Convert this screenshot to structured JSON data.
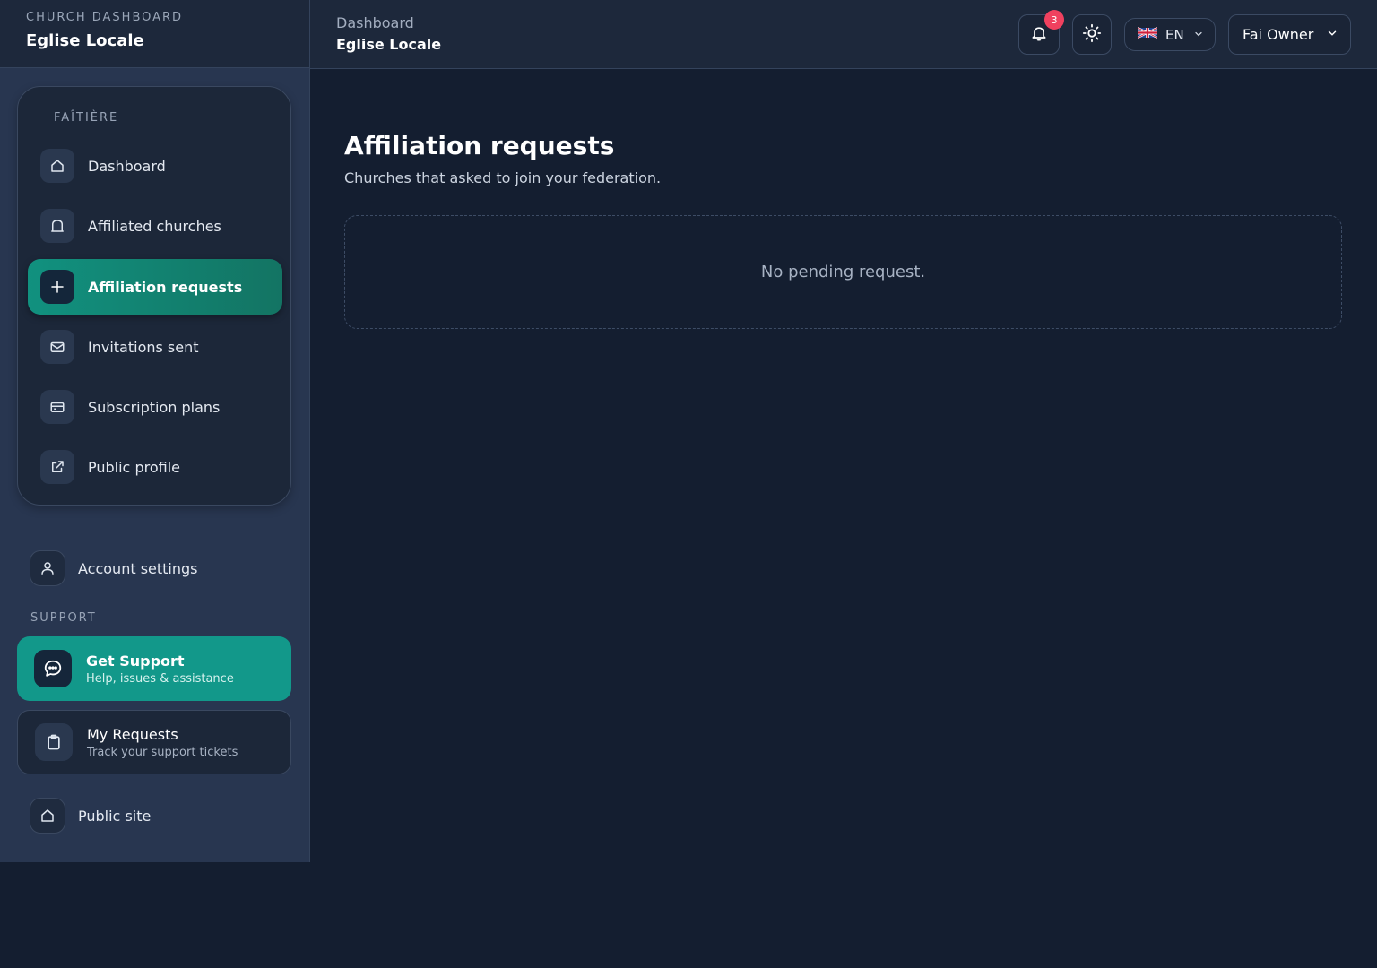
{
  "sidebar": {
    "brand": {
      "kicker": "CHURCH DASHBOARD",
      "title": "Eglise Locale"
    },
    "nav_heading": "FAÎTIÈRE",
    "items": [
      {
        "label": "Dashboard",
        "icon": "home-icon"
      },
      {
        "label": "Affiliated churches",
        "icon": "church-icon"
      },
      {
        "label": "Affiliation requests",
        "icon": "plus-icon",
        "active": true
      },
      {
        "label": "Invitations sent",
        "icon": "mail-icon"
      },
      {
        "label": "Subscription plans",
        "icon": "credit-card-icon"
      },
      {
        "label": "Public profile",
        "icon": "external-link-icon"
      }
    ],
    "account_settings": "Account settings",
    "support_heading": "SUPPORT",
    "get_support": {
      "title": "Get Support",
      "subtitle": "Help, issues & assistance"
    },
    "my_requests": {
      "title": "My Requests",
      "subtitle": "Track your support tickets"
    },
    "public_site": "Public site"
  },
  "topbar": {
    "breadcrumb_parent": "Dashboard",
    "breadcrumb_current": "Eglise Locale",
    "notification_count": "3",
    "language_code": "EN",
    "user_name": "Fai Owner"
  },
  "main": {
    "title": "Affiliation requests",
    "subtitle": "Churches that asked to join your federation.",
    "empty_message": "No pending request."
  },
  "colors": {
    "accent": "#12988a",
    "badge": "#f0415f",
    "background": "#141e30"
  }
}
